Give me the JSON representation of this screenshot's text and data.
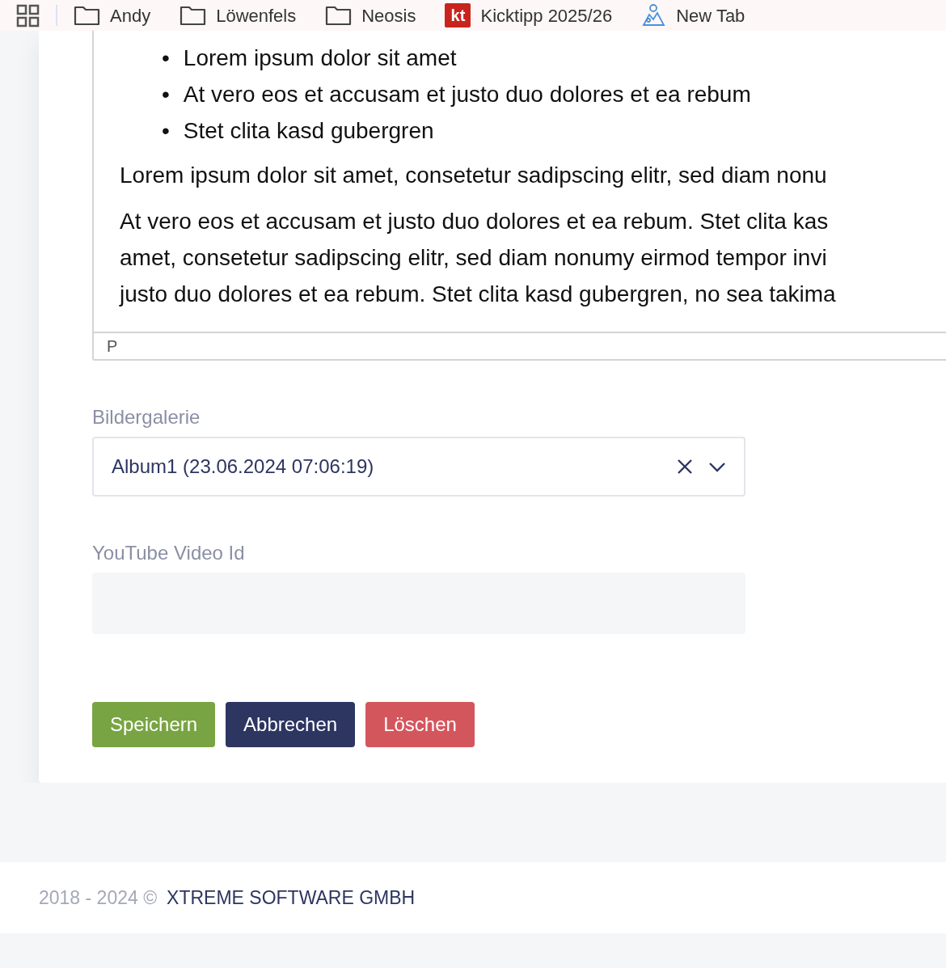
{
  "bookmarks": [
    {
      "kind": "apps"
    },
    {
      "kind": "folder",
      "label": "Andy"
    },
    {
      "kind": "folder",
      "label": "Löwenfels"
    },
    {
      "kind": "folder",
      "label": "Neosis"
    },
    {
      "kind": "site",
      "badge": "kt",
      "label": "Kicktipp 2025/26"
    },
    {
      "kind": "newtab",
      "label": "New Tab"
    }
  ],
  "editor": {
    "marker": "•",
    "bullets": [
      "Lorem ipsum dolor sit amet",
      "At vero eos et accusam et justo duo dolores et ea rebum",
      "Stet clita kasd gubergren"
    ],
    "paragraphs": [
      [
        "Lorem ipsum dolor sit amet, consetetur sadipscing elitr, sed diam nonu"
      ],
      [
        "At vero eos et accusam et justo duo dolores et ea rebum. Stet clita kas",
        "amet, consetetur sadipscing elitr, sed diam nonumy eirmod tempor invi",
        "justo duo dolores et ea rebum. Stet clita kasd gubergren, no sea takima"
      ]
    ],
    "status": "P"
  },
  "gallery": {
    "label": "Bildergalerie",
    "value": "Album1 (23.06.2024 07:06:19)"
  },
  "youtube": {
    "label": "YouTube Video Id"
  },
  "buttons": [
    {
      "kind": "save",
      "label": "Speichern"
    },
    {
      "kind": "cancel",
      "label": "Abbrechen"
    },
    {
      "kind": "delete",
      "label": "Löschen"
    }
  ],
  "footer": {
    "years": "2018 - 2024 ©",
    "company": "XTREME SOFTWARE GMBH"
  }
}
